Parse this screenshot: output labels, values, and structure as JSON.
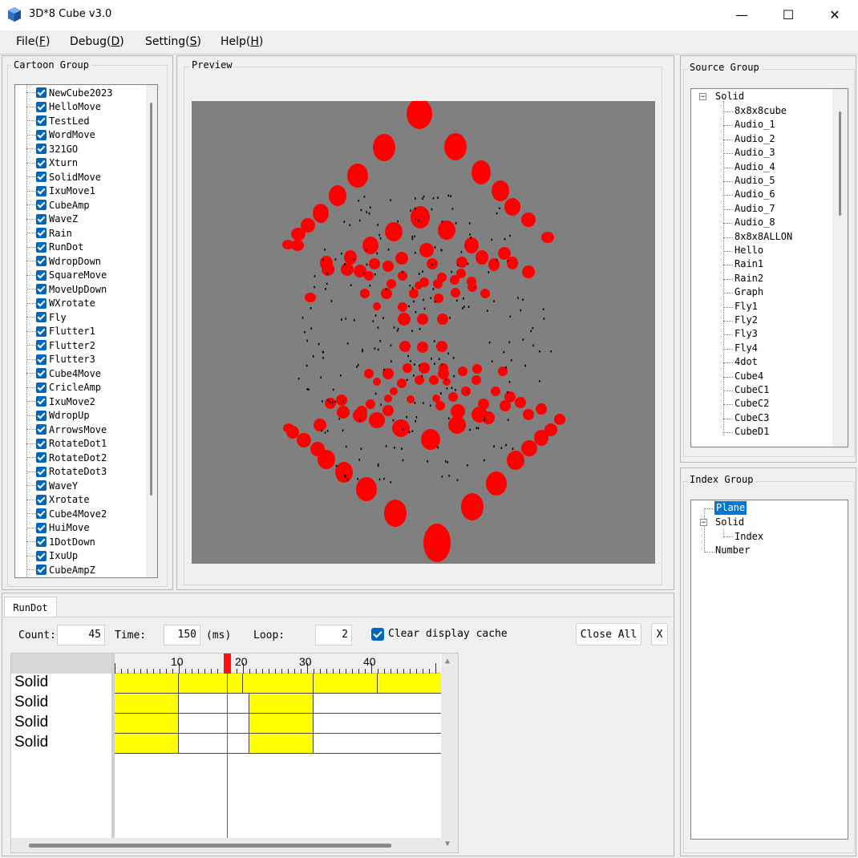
{
  "window": {
    "title": "3D*8 Cube v3.0",
    "minimize": "—",
    "maximize": "☐",
    "close": "✕"
  },
  "menu": [
    {
      "label": "File(",
      "key": "F",
      "end": ")"
    },
    {
      "label": "Debug(",
      "key": "D",
      "end": ")"
    },
    {
      "label": "Setting(",
      "key": "S",
      "end": ")"
    },
    {
      "label": "Help(",
      "key": "H",
      "end": ")"
    }
  ],
  "cartoon_group": {
    "title": "Cartoon Group",
    "items": [
      "NewCube2023",
      "HelloMove",
      "TestLed",
      "WordMove",
      "321GO",
      "Xturn",
      "SolidMove",
      "IxuMove1",
      "CubeAmp",
      "WaveZ",
      "Rain",
      "RunDot",
      "WdropDown",
      "SquareMove",
      "MoveUpDown",
      "WXrotate",
      "Fly",
      "Flutter1",
      "Flutter2",
      "Flutter3",
      "Cube4Move",
      "CricleAmp",
      "IxuMove2",
      "WdropUp",
      "ArrowsMove",
      "RotateDot1",
      "RotateDot2",
      "RotateDot3",
      "WaveY",
      "Xrotate",
      "Cube4Move2",
      "HuiMove",
      "1DotDown",
      "IxuUp",
      "CubeAmpZ"
    ],
    "checked": true
  },
  "preview": {
    "title": "Preview",
    "background": "#808080",
    "led_color": "#ff0000"
  },
  "source_group": {
    "title": "Source Group",
    "root": "Solid",
    "items": [
      "8x8x8cube",
      "Audio_1",
      "Audio_2",
      "Audio_3",
      "Audio_4",
      "Audio_5",
      "Audio_6",
      "Audio_7",
      "Audio_8",
      "8x8x8ALLON",
      "Hello",
      "Rain1",
      "Rain2",
      "Graph",
      "Fly1",
      "Fly2",
      "Fly3",
      "Fly4",
      "4dot",
      "Cube4",
      "CubeC1",
      "CubeC2",
      "CubeC3",
      "CubeD1"
    ]
  },
  "index_group": {
    "title": "Index Group",
    "plane": "Plane",
    "solid": "Solid",
    "index": "Index",
    "number": "Number"
  },
  "timeline": {
    "tab": "RunDot",
    "count_label": "Count:",
    "count": "45",
    "time_label": "Time:",
    "time": "150",
    "time_unit": "(ms)",
    "loop_label": "Loop:",
    "loop": "2",
    "clear_cache_label": "Clear display cache",
    "clear_cache_checked": true,
    "close_all": "Close All",
    "x_button": "X",
    "ticks": [
      "10",
      "20",
      "30",
      "40"
    ],
    "rows": [
      "Solid",
      "Solid",
      "Solid",
      "Solid"
    ],
    "playhead_frame": 17,
    "accent_color": "#ffff00",
    "playhead_color": "#ff0000"
  }
}
